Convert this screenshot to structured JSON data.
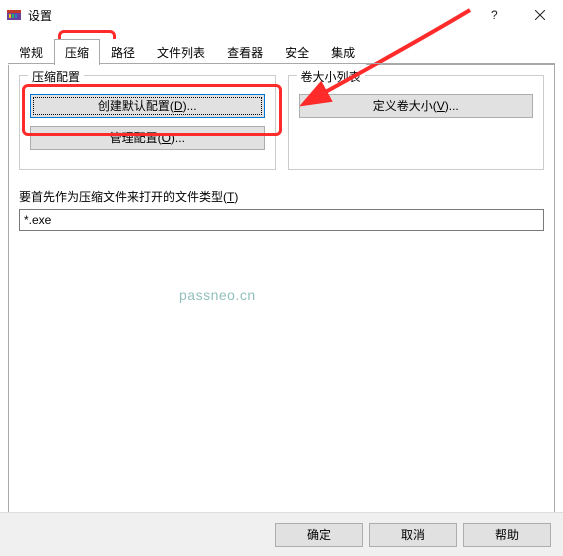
{
  "title": "设置",
  "tabs": {
    "general": "常规",
    "compression": "压缩",
    "path": "路径",
    "filelist": "文件列表",
    "viewer": "查看器",
    "security": "安全",
    "integration": "集成"
  },
  "groups": {
    "compression_profile": "压缩配置",
    "volume_list": "卷大小列表"
  },
  "buttons": {
    "create_default_pre": "创建默认配置(",
    "create_default_key": "D",
    "create_default_post": ")...",
    "manage_pre": "管理配置(",
    "manage_key": "O",
    "manage_post": ")...",
    "define_vol_pre": "定义卷大小(",
    "define_vol_key": "V",
    "define_vol_post": ")..."
  },
  "label": {
    "filetype_pre": "要首先作为压缩文件来打开的文件类型(",
    "filetype_key": "T",
    "filetype_post": ")"
  },
  "input": {
    "value": "*.exe"
  },
  "watermark": "passneo.cn",
  "footer": {
    "ok": "确定",
    "cancel": "取消",
    "help": "帮助"
  }
}
